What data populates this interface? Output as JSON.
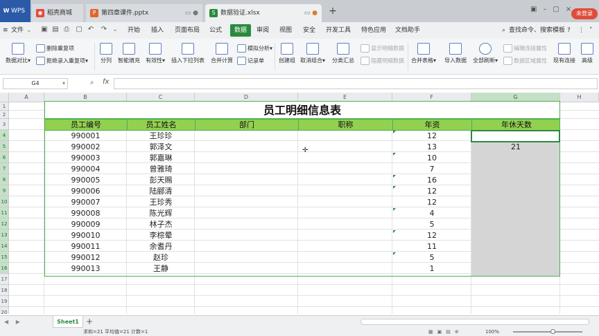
{
  "window": {
    "tabs": [
      {
        "label": "WPS"
      },
      {
        "label": "稻壳商城"
      },
      {
        "label": "第四章课件.pptx"
      },
      {
        "label": "数据验证.xlsx"
      }
    ],
    "login_label": "未登录"
  },
  "menu": {
    "file_label": "文件",
    "items": [
      "开始",
      "插入",
      "页面布局",
      "公式",
      "数据",
      "审阅",
      "视图",
      "安全",
      "开发工具",
      "特色应用",
      "文档助手"
    ],
    "active": "数据",
    "search_label": "查找命令、搜索模板"
  },
  "ribbon": {
    "data_compare": "数据对比",
    "remove_dup": "删除重复项",
    "reject_dup": "拒绝录入重复项",
    "split": "分列",
    "smart_fill": "智能填充",
    "validity": "有效性",
    "insert_dropdown": "插入下拉列表",
    "merge_calc": "合并计算",
    "what_if": "模拟分析",
    "record": "记录单",
    "create_group": "创建组",
    "ungroup": "取消组合",
    "subtotal": "分类汇总",
    "show_detail": "显示明细数据",
    "hide_detail": "隐藏明细数据",
    "merge_tables": "合并表格",
    "import_data": "导入数据",
    "refresh_all": "全部刷新",
    "edit_links": "编辑连接属性",
    "data_area_props": "数据区域属性",
    "existing_conn": "现有连接",
    "more": "高级"
  },
  "formula_bar": {
    "name_box": "G4",
    "fx": "fx",
    "content": ""
  },
  "columns": [
    "A",
    "B",
    "C",
    "D",
    "E",
    "F",
    "G",
    "H"
  ],
  "rows": [
    "1",
    "2",
    "3",
    "4",
    "5",
    "6",
    "7",
    "8",
    "9",
    "10",
    "11",
    "12",
    "13",
    "14",
    "15",
    "16",
    "17",
    "18",
    "19",
    "20"
  ],
  "sheet": {
    "title": "员工明细信息表",
    "headers": [
      "员工编号",
      "员工姓名",
      "部门",
      "职称",
      "年资",
      "年休天数"
    ],
    "records": [
      {
        "id": "990001",
        "name": "王珍珍",
        "years": "12",
        "leave": ""
      },
      {
        "id": "990002",
        "name": "郭泽文",
        "years": "13",
        "leave": "21"
      },
      {
        "id": "990003",
        "name": "郭嘉琳",
        "years": "10",
        "leave": ""
      },
      {
        "id": "990004",
        "name": "曾雅琦",
        "years": "7",
        "leave": ""
      },
      {
        "id": "990005",
        "name": "彭天赐",
        "years": "16",
        "leave": ""
      },
      {
        "id": "990006",
        "name": "陆郦清",
        "years": "12",
        "leave": ""
      },
      {
        "id": "990007",
        "name": "王珍秀",
        "years": "12",
        "leave": ""
      },
      {
        "id": "990008",
        "name": "陈光辉",
        "years": "4",
        "leave": ""
      },
      {
        "id": "990009",
        "name": "林子杰",
        "years": "5",
        "leave": ""
      },
      {
        "id": "990010",
        "name": "李棕晕",
        "years": "12",
        "leave": ""
      },
      {
        "id": "990011",
        "name": "余耆丹",
        "years": "11",
        "leave": ""
      },
      {
        "id": "990012",
        "name": "赵珍",
        "years": "5",
        "leave": ""
      },
      {
        "id": "990013",
        "name": "王静",
        "years": "1",
        "leave": ""
      }
    ]
  },
  "sheet_tabs": {
    "active": "Sheet1"
  },
  "status": {
    "summary": "求和=21  平均值=21  计数=1",
    "zoom": "100%"
  }
}
